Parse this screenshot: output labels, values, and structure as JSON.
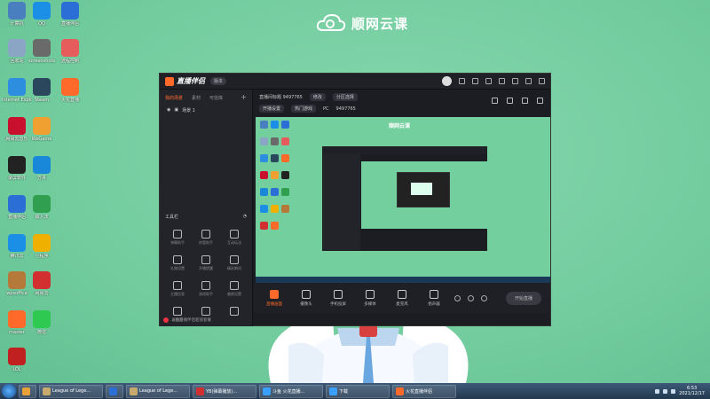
{
  "brand": {
    "text": "顺网云课"
  },
  "desktop_icons": [
    {
      "label": "计算机",
      "color": "#4a7fbf"
    },
    {
      "label": "QQ",
      "color": "#1b8fe6"
    },
    {
      "label": "直播伴侣",
      "color": "#2b6fd6"
    },
    {
      "label": "回收站",
      "color": "#8aa6c4"
    },
    {
      "label": "screenshots",
      "color": "#6a6a6a"
    },
    {
      "label": "远程控制",
      "color": "#e65c5c"
    },
    {
      "label": "Internet Explorer",
      "color": "#2d8ee0"
    },
    {
      "label": "Steam",
      "color": "#2a475e"
    },
    {
      "label": "火花直播",
      "color": "#ff6a2a"
    },
    {
      "label": "网易云音乐",
      "color": "#c8102e"
    },
    {
      "label": "WeGame",
      "color": "#f0a030"
    },
    {
      "label": "录屏软件",
      "color": "#222"
    },
    {
      "label": "方舟",
      "color": "#1a88d8"
    },
    {
      "label": "直播伴侣",
      "color": "#2b6fd6"
    },
    {
      "label": "输入法",
      "color": "#30a050"
    },
    {
      "label": "腾讯云",
      "color": "#1b8fe6"
    },
    {
      "label": "小程序",
      "color": "#f0b000"
    },
    {
      "label": "wpsoffice",
      "color": "#b57a3a"
    },
    {
      "label": "网易云",
      "color": "#d23030"
    },
    {
      "label": "master",
      "color": "#ff6a2a"
    },
    {
      "label": "微信",
      "color": "#2ec950"
    },
    {
      "label": "LOL",
      "color": "#c02020"
    }
  ],
  "app": {
    "title": "直播伴侣",
    "version": "版本",
    "left_tabs": [
      "我的场景",
      "素材",
      "可信库"
    ],
    "scene_name": "场景 1",
    "tools_header": "工具栏",
    "tools": [
      "弹幕助手",
      "房管助手",
      "互动玩法",
      "礼物设置",
      "开播提醒",
      "精彩瞬间",
      "主播信息",
      "游戏助手",
      "美颜设置",
      "直播间",
      "",
      ""
    ],
    "bottom_badge": "斗鱼直播伴侣超值套餐",
    "info_title": "直播间标题 9497765",
    "info_btn": "修改",
    "info_tag": "分区选择",
    "info_row2": [
      "开播设置",
      "热门游戏",
      "PC",
      "9497765"
    ],
    "controls": [
      {
        "label": "直播画面",
        "hot": true
      },
      {
        "label": "摄像头",
        "hot": false
      },
      {
        "label": "手机投屏",
        "hot": false
      },
      {
        "label": "多媒体",
        "hot": false
      },
      {
        "label": "麦克风",
        "hot": false
      },
      {
        "label": "扬声器",
        "hot": false
      }
    ],
    "start_btn": "开始直播"
  },
  "taskbar": {
    "items": [
      {
        "label": "",
        "color": "#e9a13a"
      },
      {
        "label": "League of Lege...",
        "color": "#c8aa6e"
      },
      {
        "label": "",
        "color": "#2b6fd6"
      },
      {
        "label": "League of Lege...",
        "color": "#c8aa6e"
      },
      {
        "label": "YB(弹幕播放)...",
        "color": "#d23030"
      },
      {
        "label": "斗鱼 火花直播...",
        "color": "#3aa0ff"
      },
      {
        "label": "下载",
        "color": "#3aa0ff"
      },
      {
        "label": "火花直播伴侣",
        "color": "#ff6a2a"
      }
    ],
    "time": "6:53",
    "date": "2021/12/17"
  }
}
